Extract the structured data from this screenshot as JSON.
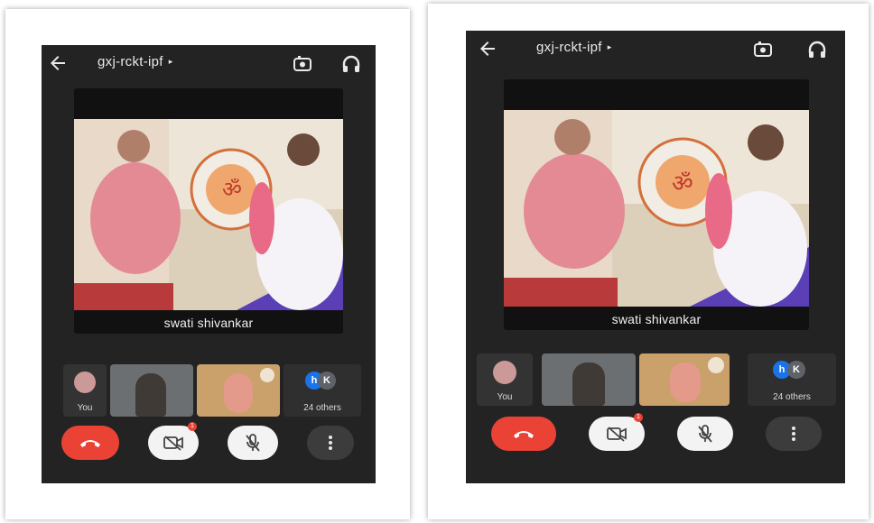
{
  "screens": [
    {
      "meeting_code": "gxj-rckt-ipf",
      "speaker_name": "swati shivankar",
      "self_label": "You",
      "others_label": "24 others",
      "chips": [
        "h",
        "K"
      ],
      "mic_badge": "1"
    },
    {
      "meeting_code": "gxj-rckt-ipf",
      "speaker_name": "swati shivankar",
      "self_label": "You",
      "others_label": "24 others",
      "chips": [
        "h",
        "K"
      ],
      "mic_badge": "1"
    }
  ],
  "colors": {
    "end_call": "#ea4335",
    "chip_blue": "#1a73e8",
    "chip_gray": "#5f6368",
    "app_bg": "#232323"
  },
  "icons": [
    "back-arrow-icon",
    "switch-camera-icon",
    "headphones-icon",
    "end-call-icon",
    "camera-off-icon",
    "mic-off-icon",
    "more-options-icon",
    "pin-icon"
  ]
}
